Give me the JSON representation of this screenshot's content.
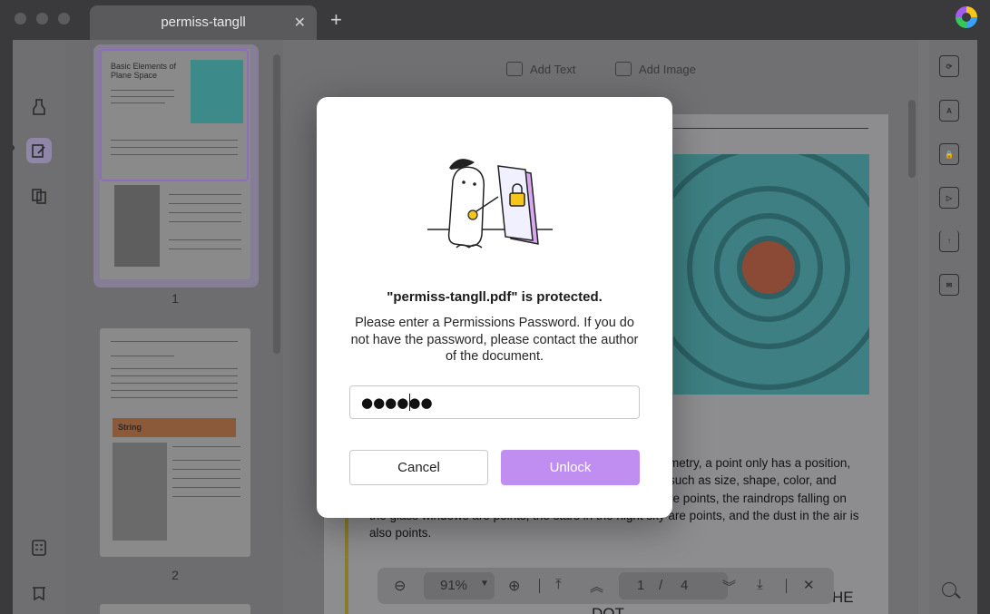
{
  "window": {
    "tab_title": "permiss-tangll",
    "tab_close": "✕",
    "new_tab": "+"
  },
  "toolbar": {
    "add_text_label": "Add Text",
    "add_image_label": "Add Image"
  },
  "thumbnails": {
    "page1_number": "1",
    "page2_number": "2",
    "page1_title": "Basic Elements of Plane Space",
    "page2_highlight": "String"
  },
  "document": {
    "visible_text_lines": [
      "metry, a point only has a position,",
      "such as size, shape, color, and",
      "re points, the raindrops falling on",
      "the glass windows are points, the stars in the night sky are points, and the dust in the air is",
      "also points."
    ],
    "bottom_heading_fragment": "HE",
    "bottom_heading_fragment2": "DOT"
  },
  "zoom_bar": {
    "zoom_value": "91%",
    "current_page": "1",
    "page_separator": "/",
    "total_pages": "4",
    "zoom_out_icon": "minus-circle",
    "zoom_in_icon": "plus-circle",
    "first_page_icon": "chevron-bar-up",
    "prev_page_icon": "double-chevron-up",
    "next_page_icon": "double-chevron-down",
    "last_page_icon": "chevron-bar-down",
    "close_icon": "close"
  },
  "dialog": {
    "title": "\"permiss-tangll.pdf\" is protected.",
    "message": "Please enter a Permissions Password. If you do not have the password, please contact the author of the document.",
    "password_value": "●●●●●●",
    "cancel_label": "Cancel",
    "unlock_label": "Unlock",
    "unlock_color": "#c08ef0"
  },
  "colors": {
    "accent_purple": "#8e6dc0",
    "dialog_bg": "#ffffff"
  }
}
